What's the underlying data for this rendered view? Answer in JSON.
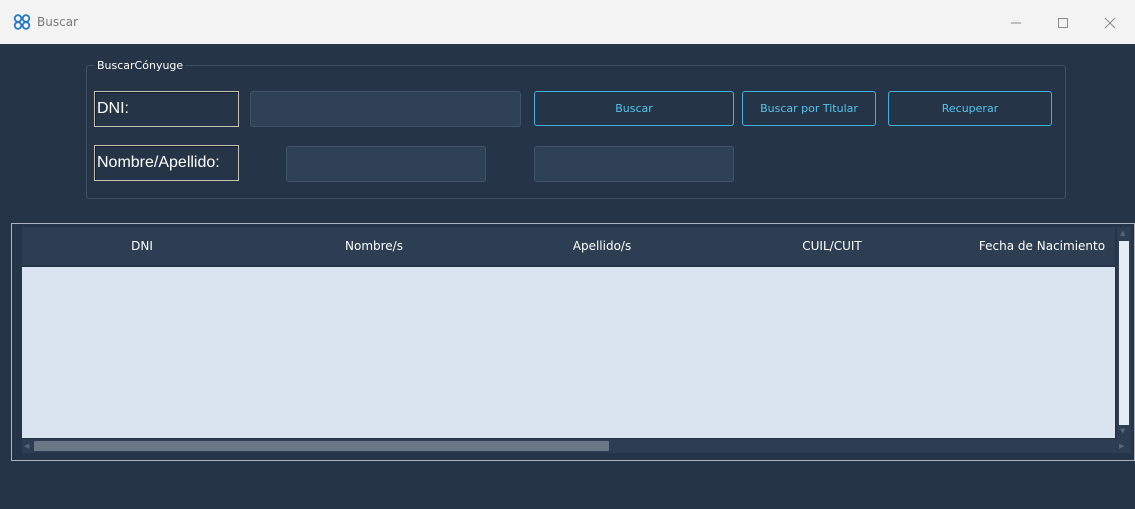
{
  "window": {
    "title": "Buscar"
  },
  "group": {
    "title": "BuscarCónyuge"
  },
  "labels": {
    "dni": "DNI:",
    "nombre": "Nombre/Apellido:"
  },
  "inputs": {
    "dni_value": "",
    "nombre_value": "",
    "apellido_value": ""
  },
  "buttons": {
    "buscar": "Buscar",
    "buscar_titular": "Buscar por Titular",
    "recuperar": "Recuperar"
  },
  "table": {
    "columns": [
      "DNI",
      "Nombre/s",
      "Apellido/s",
      "CUIL/CUIT",
      "Fecha de Nacimiento"
    ],
    "rows": []
  },
  "colors": {
    "background": "#253447",
    "accent": "#3fb3dc",
    "grid_body": "#dae4f1"
  }
}
